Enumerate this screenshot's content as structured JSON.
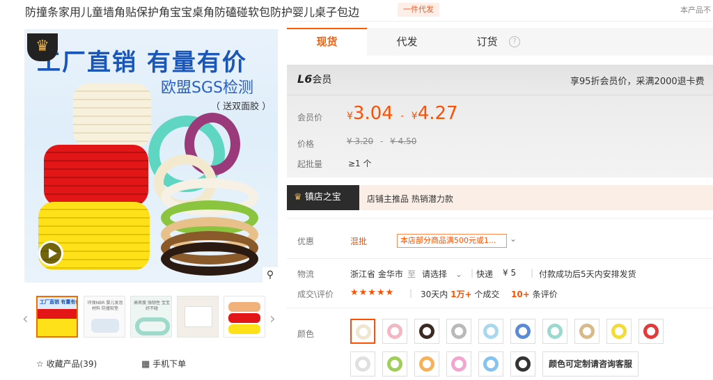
{
  "title": "防撞条家用儿童墙角贴保护角宝宝桌角防磕碰软包防护婴儿桌子包边",
  "tag": "一件代发",
  "top_right": "本产品不",
  "main_image": {
    "headline": "工厂直销 有量有价",
    "subline": "欧盟SGS检测",
    "note": "（ 送双面胶 ）"
  },
  "thumbnails": [
    {
      "label": "工厂直销 有量有价"
    },
    {
      "label": "环保NBR 婴儿发泡材料 防撞软垫"
    },
    {
      "label": "高密度 强韧性 宝宝好不碰"
    },
    {
      "label": ""
    },
    {
      "label": ""
    }
  ],
  "actions": {
    "favorite": "收藏产品(39)",
    "mobile": "手机下单"
  },
  "tabs": [
    "现货",
    "代发",
    "订货"
  ],
  "tab_help": "?",
  "member": {
    "level": "L6",
    "level_suffix": "会员",
    "benefit": "享95折会员价，采满2000退卡费"
  },
  "pricing": {
    "member_price_label": "会员价",
    "member_price_low": "3.04",
    "member_price_high": "4.27",
    "currency": "¥",
    "dash": "-",
    "price_label": "价格",
    "price_low": "3.20",
    "price_high": "4.50",
    "min_order_label": "起批量",
    "min_order": "≥1 个"
  },
  "treasure": {
    "badge": "镇店之宝",
    "text": "店铺主推品 热销潜力款"
  },
  "promo": {
    "label": "优惠",
    "type": "混批",
    "chip": "本店部分商品满500元或1..."
  },
  "logistics": {
    "label": "物流",
    "origin": "浙江省 金华市",
    "to": "至",
    "dest": "请选择",
    "express": "快递",
    "fee": "¥ 5",
    "ship_note": "付款成功后5天内安排发货"
  },
  "deals": {
    "label": "成交\\评价",
    "stars": "★★★★★",
    "period": "30天内",
    "count": "1万+",
    "count_suffix": "个成交",
    "reviews": "10+",
    "reviews_suffix": "条评价"
  },
  "color": {
    "label": "颜色",
    "custom_button": "颜色可定制请咨询客服"
  },
  "colors": {
    "accent": "#ff5000",
    "brand_tab": "#ff5a00"
  }
}
